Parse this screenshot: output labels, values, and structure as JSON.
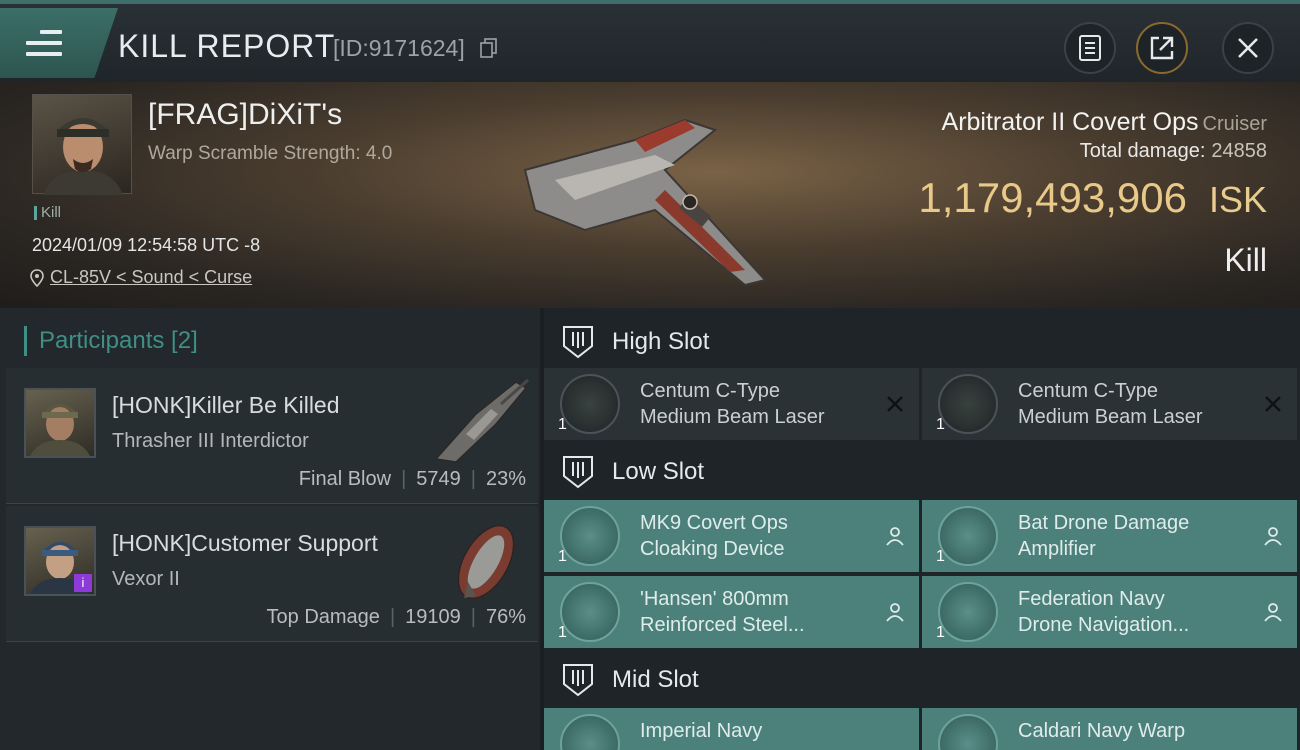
{
  "header": {
    "title": "KILL REPORT",
    "kill_id": "[ID:9171624]",
    "icons": {
      "menu": "menu-icon",
      "copy": "copy-icon",
      "report": "clipboard-icon",
      "share": "share-icon",
      "close": "close-icon"
    }
  },
  "victim": {
    "name": "[FRAG]DiXiT's",
    "scramble": "Warp Scramble Strength: 4.0",
    "kill_tag": "Kill",
    "timestamp": "2024/01/09 12:54:58 UTC -8",
    "location": "CL-85V < Sound < Curse"
  },
  "ship": {
    "name": "Arbitrator II Covert Ops",
    "class": "Cruiser",
    "total_damage_label": "Total damage:",
    "total_damage": "24858",
    "isk": "1,179,493,906",
    "isk_unit": "ISK",
    "result": "Kill"
  },
  "participants": {
    "header": "Participants [2]",
    "items": [
      {
        "name": "[HONK]Killer Be Killed",
        "ship": "Thrasher III Interdictor",
        "role": "Final Blow",
        "damage": "5749",
        "percent": "23%"
      },
      {
        "name": "[HONK]Customer Support",
        "ship": "Vexor II",
        "role": "Top Damage",
        "damage": "19109",
        "percent": "76%"
      }
    ]
  },
  "fittings": {
    "high": {
      "title": "High Slot",
      "items": [
        {
          "name1": "Centum C-Type",
          "name2": "Medium Beam Laser",
          "qty": "1",
          "status": "destroyed"
        },
        {
          "name1": "Centum C-Type",
          "name2": "Medium Beam Laser",
          "qty": "1",
          "status": "destroyed"
        }
      ]
    },
    "low": {
      "title": "Low Slot",
      "items": [
        {
          "name1": "MK9 Covert Ops",
          "name2": "Cloaking Device",
          "qty": "1",
          "status": "dropped"
        },
        {
          "name1": "Bat Drone Damage",
          "name2": "Amplifier",
          "qty": "1",
          "status": "dropped"
        },
        {
          "name1": "'Hansen' 800mm",
          "name2": "Reinforced Steel...",
          "qty": "1",
          "status": "dropped"
        },
        {
          "name1": "Federation Navy",
          "name2": "Drone Navigation...",
          "qty": "1",
          "status": "dropped"
        }
      ]
    },
    "mid": {
      "title": "Mid Slot",
      "items": [
        {
          "name1": "Imperial Navy",
          "name2": "",
          "qty": "",
          "status": "dropped"
        },
        {
          "name1": "Caldari Navy Warp",
          "name2": "",
          "qty": "",
          "status": "dropped"
        }
      ]
    }
  },
  "colors": {
    "accent": "#3f8f86",
    "isk": "#e8c98a",
    "fitted": "#4c817b"
  }
}
